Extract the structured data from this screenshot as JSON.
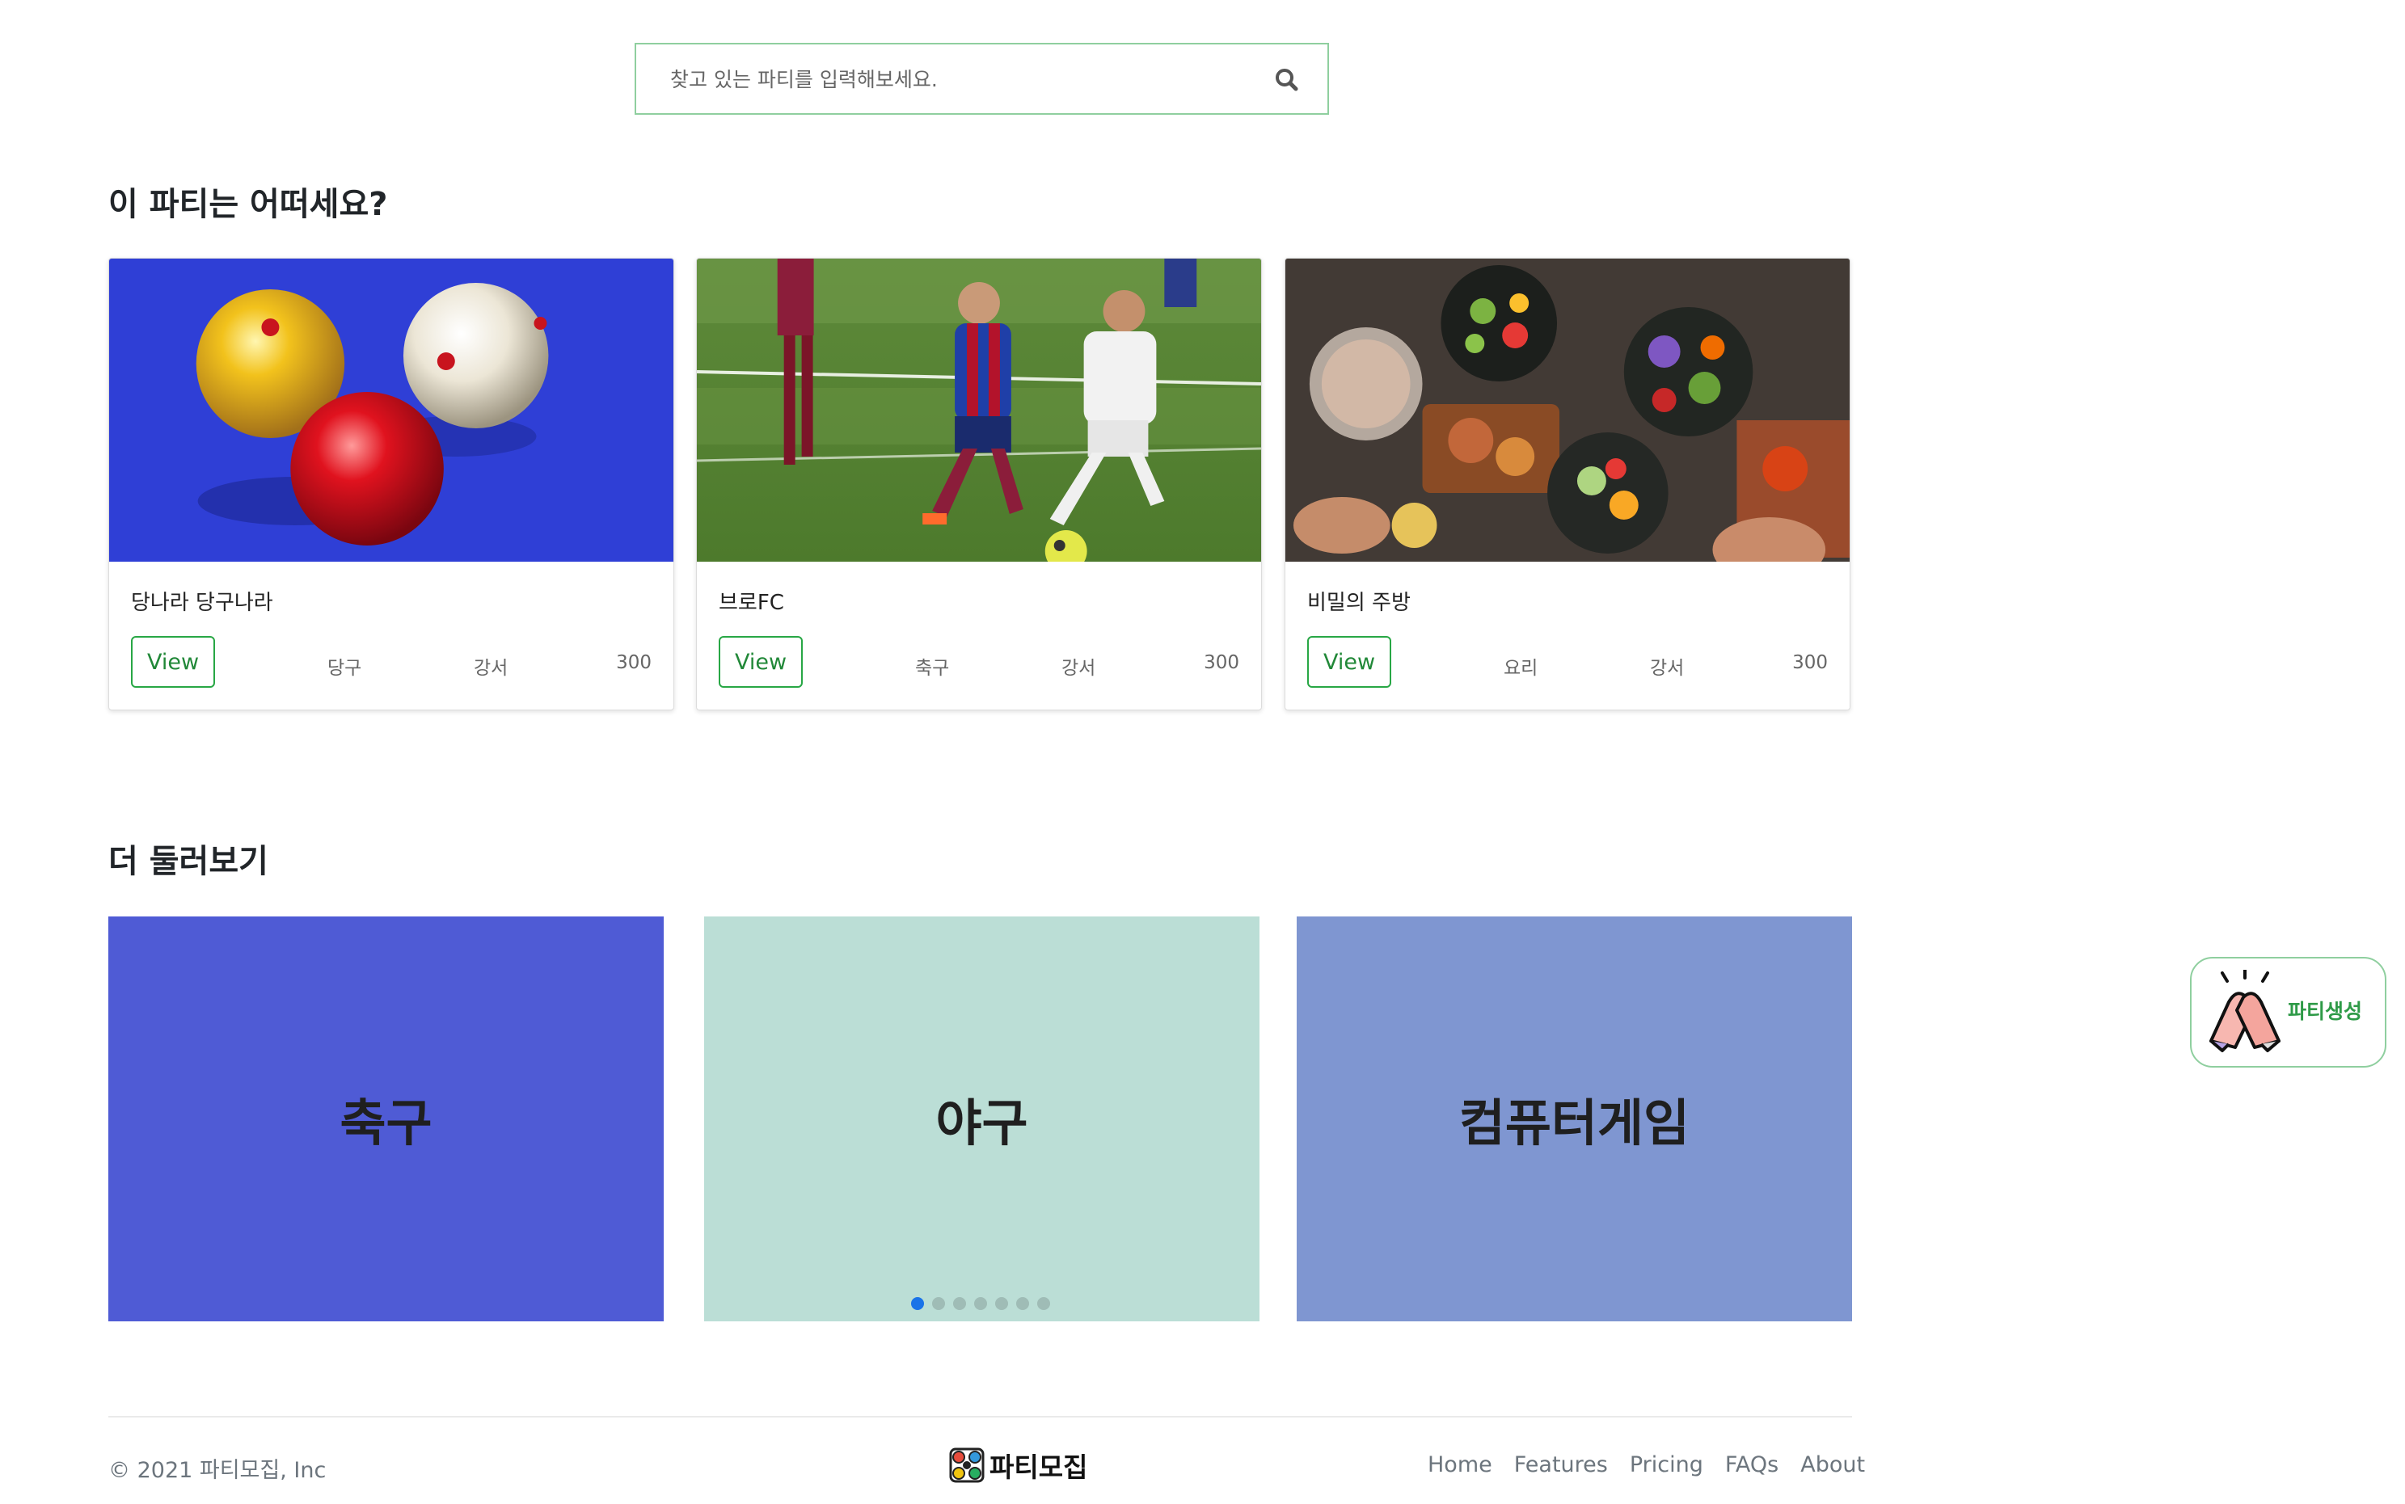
{
  "search": {
    "placeholder": "찾고 있는 파티를 입력해보세요."
  },
  "recommend": {
    "title": "이 파티는 어떠세요?",
    "cards": [
      {
        "title": "당나라 당구나라",
        "view_label": "View",
        "category": "당구",
        "location": "강서",
        "count": "300"
      },
      {
        "title": "브로FC",
        "view_label": "View",
        "category": "축구",
        "location": "강서",
        "count": "300"
      },
      {
        "title": "비밀의 주방",
        "view_label": "View",
        "category": "요리",
        "location": "강서",
        "count": "300"
      }
    ]
  },
  "browse": {
    "title": "더 둘러보기",
    "tiles": [
      {
        "label": "축구",
        "color": "#4f5bd5"
      },
      {
        "label": "야구",
        "color": "#bbded6"
      },
      {
        "label": "컴퓨터게임",
        "color": "#7f96d1"
      }
    ],
    "carousel": {
      "slide_count": 7,
      "active_index": 0
    }
  },
  "create_party": {
    "label": "파티생성",
    "icon": "high-five-icon"
  },
  "footer": {
    "copyright": "© 2021 파티모집, Inc",
    "brand": "파티모집",
    "links": [
      "Home",
      "Features",
      "Pricing",
      "FAQs",
      "About"
    ]
  },
  "colors": {
    "accent_green": "#28a745",
    "tile_blue": "#4f5bd5",
    "tile_mint": "#bbded6",
    "tile_periwinkle": "#7f96d1"
  }
}
